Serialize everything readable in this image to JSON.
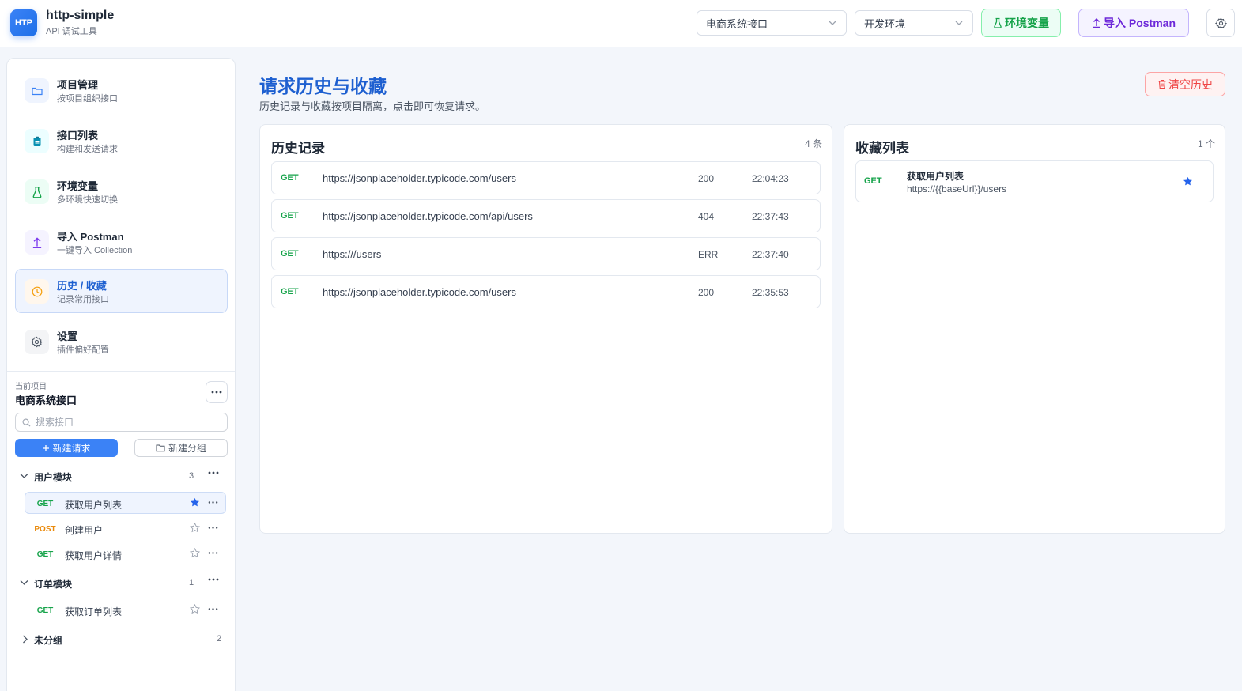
{
  "app": {
    "logo_text": "HTP",
    "name": "http-simple",
    "subtitle": "API 调试工具"
  },
  "header": {
    "project_select": "电商系统接口",
    "env_select": "开发环境",
    "env_button": "环境变量",
    "import_button": "导入 Postman",
    "icons": [
      "chevron-down-icon",
      "flask-icon",
      "upload-icon",
      "gear-icon"
    ]
  },
  "sidebar": {
    "nav": [
      {
        "title": "项目管理",
        "sub": "按项目组织接口",
        "icon": "folder-icon",
        "color": "#3b82f6"
      },
      {
        "title": "接口列表",
        "sub": "构建和发送请求",
        "icon": "clipboard-icon",
        "color": "#0891b2"
      },
      {
        "title": "环境变量",
        "sub": "多环境快速切换",
        "icon": "flask-icon",
        "color": "#16a34a"
      },
      {
        "title": "导入 Postman",
        "sub": "一键导入 Collection",
        "icon": "upload-icon",
        "color": "#7c3aed"
      },
      {
        "title": "历史 / 收藏",
        "sub": "记录常用接口",
        "icon": "clock-icon",
        "color": "#f59e0b"
      },
      {
        "title": "设置",
        "sub": "插件偏好配置",
        "icon": "gear-icon",
        "color": "#4b5563"
      }
    ],
    "current_project_label": "当前项目",
    "current_project": "电商系统接口",
    "search_placeholder": "搜索接口",
    "new_request": "新建请求",
    "new_group": "新建分组",
    "groups": [
      {
        "name": "用户模块",
        "count": "3",
        "expanded": true,
        "requests": [
          {
            "method": "GET",
            "name": "获取用户列表",
            "starred": true,
            "active": true
          },
          {
            "method": "POST",
            "name": "创建用户",
            "starred": false,
            "active": false
          },
          {
            "method": "GET",
            "name": "获取用户详情",
            "starred": false,
            "active": false
          }
        ]
      },
      {
        "name": "订单模块",
        "count": "1",
        "expanded": true,
        "requests": [
          {
            "method": "GET",
            "name": "获取订单列表",
            "starred": false,
            "active": false
          }
        ]
      },
      {
        "name": "未分组",
        "count": "2",
        "expanded": false,
        "requests": []
      }
    ]
  },
  "main": {
    "title": "请求历史与收藏",
    "subtitle": "历史记录与收藏按项目隔离，点击即可恢复请求。",
    "clear_button": "清空历史",
    "history": {
      "title": "历史记录",
      "count": "4 条",
      "rows": [
        {
          "method": "GET",
          "url": "https://jsonplaceholder.typicode.com/users",
          "status": "200",
          "time": "22:04:23"
        },
        {
          "method": "GET",
          "url": "https://jsonplaceholder.typicode.com/api/users",
          "status": "404",
          "time": "22:37:43"
        },
        {
          "method": "GET",
          "url": "https:///users",
          "status": "ERR",
          "time": "22:37:40"
        },
        {
          "method": "GET",
          "url": "https://jsonplaceholder.typicode.com/users",
          "status": "200",
          "time": "22:35:53"
        }
      ]
    },
    "favorites": {
      "title": "收藏列表",
      "count": "1 个",
      "rows": [
        {
          "method": "GET",
          "name": "获取用户列表",
          "url": "https://{{baseUrl}}/users"
        }
      ]
    }
  },
  "colors": {
    "accent": "#3b82f6",
    "title": "#1d5fd0",
    "get": "#16a34a",
    "post": "#ea8a0c",
    "danger": "#ef4444",
    "env": "#16a34a",
    "import": "#6d28d9"
  }
}
